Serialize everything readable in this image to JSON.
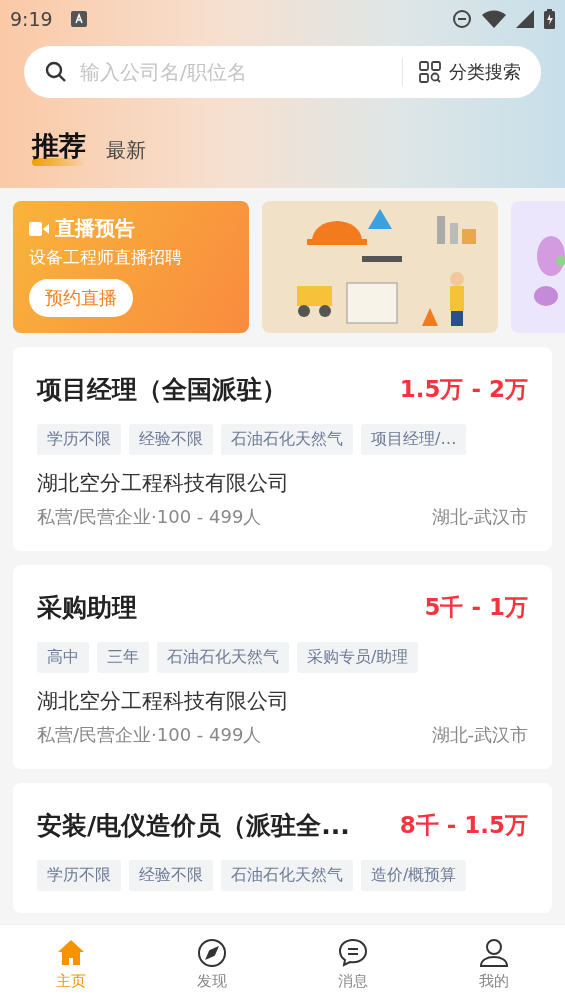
{
  "status_bar": {
    "time": "9:19"
  },
  "search": {
    "placeholder": "输入公司名/职位名",
    "category_button": "分类搜索"
  },
  "tabs": [
    {
      "label": "推荐",
      "selected": true
    },
    {
      "label": "最新",
      "selected": false
    }
  ],
  "banners": [
    {
      "kind": "live",
      "title": "直播预告",
      "subtitle": "设备工程师直播招聘",
      "button": "预约直播"
    },
    {
      "kind": "picture"
    },
    {
      "kind": "picture"
    }
  ],
  "jobs": [
    {
      "title": "项目经理（全国派驻）",
      "salary": "1.5万 - 2万",
      "tags": [
        "学历不限",
        "经验不限",
        "石油石化天然气",
        "项目经理/…"
      ],
      "company": "湖北空分工程科技有限公司",
      "info": "私营/民营企业·100 - 499人",
      "location": "湖北-武汉市"
    },
    {
      "title": "采购助理",
      "salary": "5千 - 1万",
      "tags": [
        "高中",
        "三年",
        "石油石化天然气",
        "采购专员/助理"
      ],
      "company": "湖北空分工程科技有限公司",
      "info": "私营/民营企业·100 - 499人",
      "location": "湖北-武汉市"
    },
    {
      "title": "安装/电仪造价员（派驻全...",
      "salary": "8千 - 1.5万",
      "tags": [
        "学历不限",
        "经验不限",
        "石油石化天然气",
        "造价/概预算"
      ]
    }
  ],
  "bottom_nav": [
    {
      "label": "主页",
      "selected": true
    },
    {
      "label": "发现",
      "selected": false
    },
    {
      "label": "消息",
      "selected": false
    },
    {
      "label": "我的",
      "selected": false
    }
  ]
}
